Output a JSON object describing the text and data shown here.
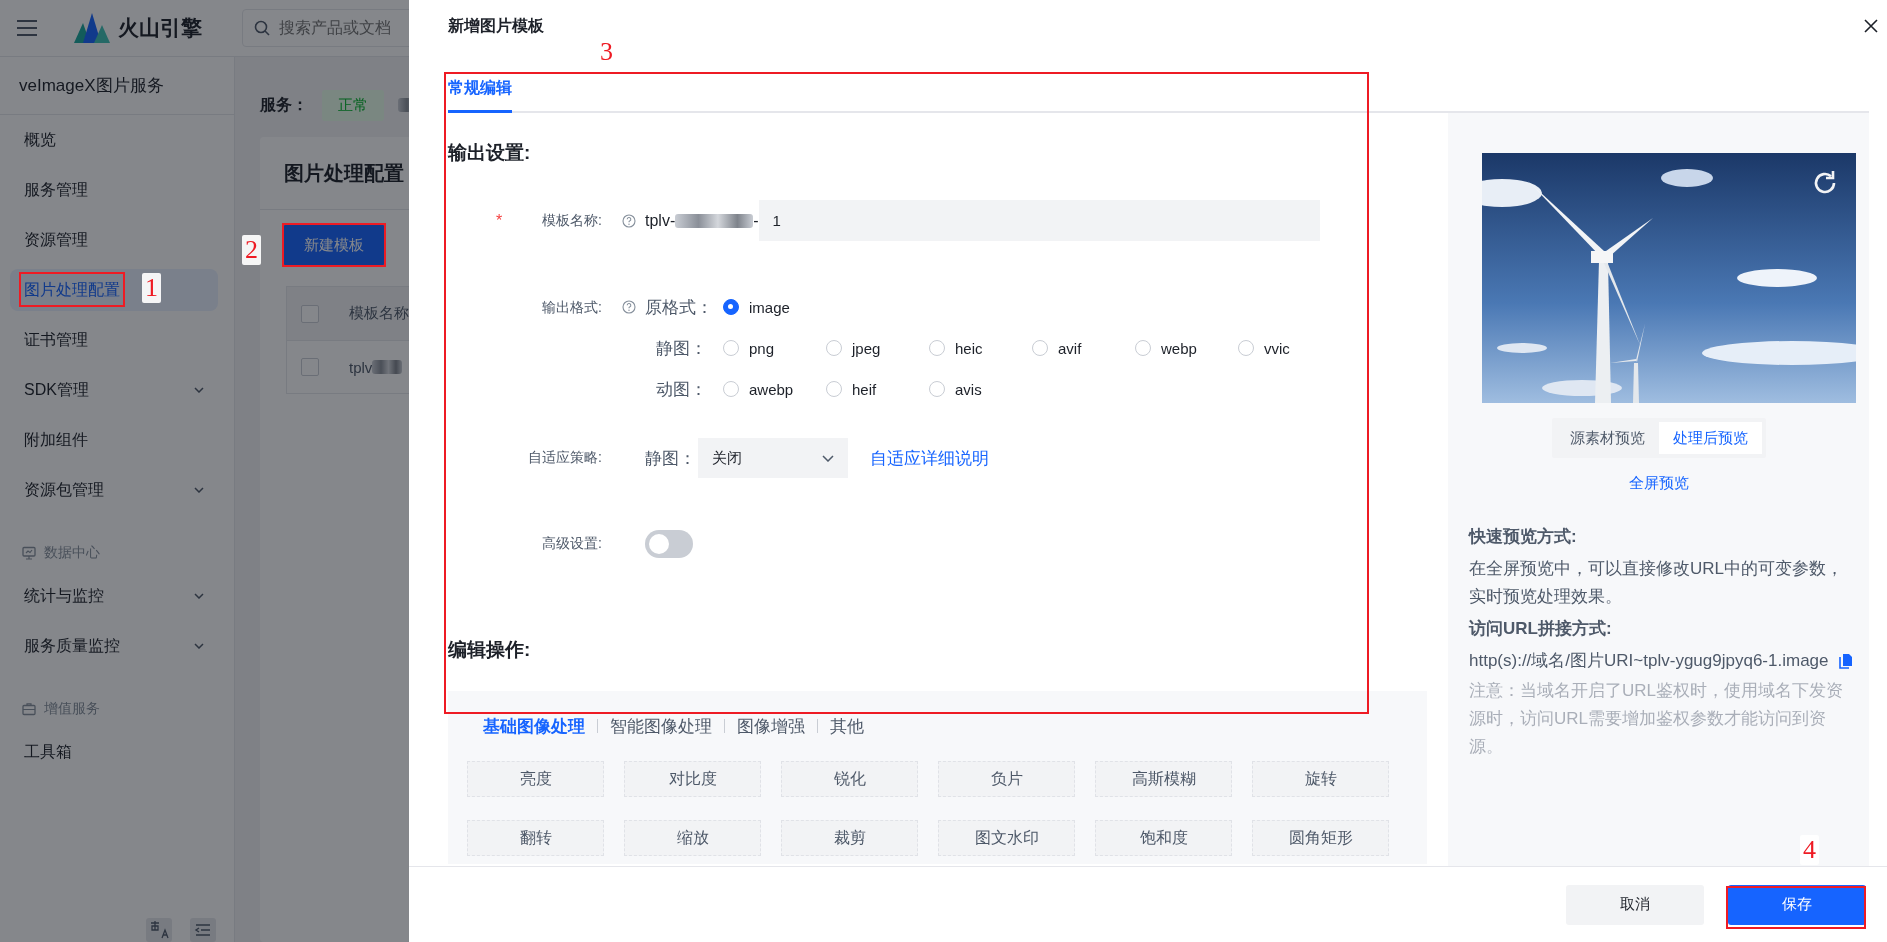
{
  "topbar": {
    "brand": "火山引擎",
    "search": {
      "placeholder": "搜索产品或文档"
    }
  },
  "sidebar": {
    "title": "veImageX图片服务",
    "items": [
      {
        "kind": "item",
        "label": "概览",
        "selected": false,
        "expandable": false
      },
      {
        "kind": "item",
        "label": "服务管理",
        "selected": false,
        "expandable": false
      },
      {
        "kind": "item",
        "label": "资源管理",
        "selected": false,
        "expandable": false
      },
      {
        "kind": "item",
        "label": "图片处理配置",
        "selected": true,
        "expandable": false
      },
      {
        "kind": "item",
        "label": "证书管理",
        "selected": false,
        "expandable": false
      },
      {
        "kind": "item",
        "label": "SDK管理",
        "selected": false,
        "expandable": true
      },
      {
        "kind": "item",
        "label": "附加组件",
        "selected": false,
        "expandable": false
      },
      {
        "kind": "item",
        "label": "资源包管理",
        "selected": false,
        "expandable": true
      },
      {
        "kind": "section",
        "label": "数据中心"
      },
      {
        "kind": "item",
        "label": "统计与监控",
        "selected": false,
        "expandable": true
      },
      {
        "kind": "item",
        "label": "服务质量监控",
        "selected": false,
        "expandable": true
      },
      {
        "kind": "section",
        "label": "增值服务"
      },
      {
        "kind": "item",
        "label": "工具箱",
        "selected": false,
        "expandable": false
      }
    ]
  },
  "main": {
    "service_label": "服务：",
    "status": "正常",
    "card_title": "图片处理配置",
    "new_button": "新建模板",
    "table": {
      "header_checked": false,
      "columns": [
        "模板名称"
      ],
      "rows": [
        {
          "checked": false,
          "cells": [
            "tplv"
          ]
        }
      ]
    }
  },
  "drawer": {
    "title": "新增图片模板",
    "tabs": [
      {
        "label": "常规编辑",
        "selected": true
      }
    ],
    "output_heading": "输出设置:",
    "name_field": {
      "label": "模板名称:",
      "required_mark": "*",
      "prefix_start": "tplv-",
      "prefix_end": "-",
      "value": "1"
    },
    "format": {
      "label": "输出格式:",
      "groups": [
        {
          "label": "原格式：",
          "options": [
            {
              "label": "image",
              "selected": true
            }
          ]
        },
        {
          "label": "静图：",
          "options": [
            {
              "label": "png",
              "selected": false
            },
            {
              "label": "jpeg",
              "selected": false
            },
            {
              "label": "heic",
              "selected": false
            },
            {
              "label": "avif",
              "selected": false
            },
            {
              "label": "webp",
              "selected": false
            },
            {
              "label": "vvic",
              "selected": false
            }
          ]
        },
        {
          "label": "动图：",
          "options": [
            {
              "label": "awebp",
              "selected": false
            },
            {
              "label": "heif",
              "selected": false
            },
            {
              "label": "avis",
              "selected": false
            }
          ]
        }
      ]
    },
    "adaptive": {
      "label": "自适应策略:",
      "sub_label": "静图：",
      "value": "关闭",
      "link": "自适应详细说明"
    },
    "advanced": {
      "label": "高级设置:",
      "on": false
    },
    "ops_heading": "编辑操作:",
    "ops_tabs": [
      {
        "label": "基础图像处理",
        "selected": true
      },
      {
        "label": "智能图像处理",
        "selected": false
      },
      {
        "label": "图像增强",
        "selected": false
      },
      {
        "label": "其他",
        "selected": false
      }
    ],
    "ops": [
      "亮度",
      "对比度",
      "锐化",
      "负片",
      "高斯模糊",
      "旋转",
      "翻转",
      "缩放",
      "裁剪",
      "图文水印",
      "饱和度",
      "圆角矩形"
    ],
    "preview": {
      "modes": [
        {
          "label": "源素材预览",
          "selected": false
        },
        {
          "label": "处理后预览",
          "selected": true
        }
      ],
      "fullscreen": "全屏预览",
      "quick_title": "快速预览方式:",
      "quick_text": "在全屏预览中，可以直接修改URL中的可变参数，实时预览处理效果。",
      "url_title": "访问URL拼接方式:",
      "url": "http(s)://域名/图片URI~tplv-ygug9jpyq6-1.image",
      "note": "注意：当域名开启了URL鉴权时，使用域名下发资源时，访问URL需要增加鉴权参数才能访问到资源。"
    },
    "footer": {
      "cancel": "取消",
      "save": "保存"
    }
  },
  "annotations": [
    {
      "label": "1"
    },
    {
      "label": "2"
    },
    {
      "label": "3"
    },
    {
      "label": "4"
    }
  ]
}
